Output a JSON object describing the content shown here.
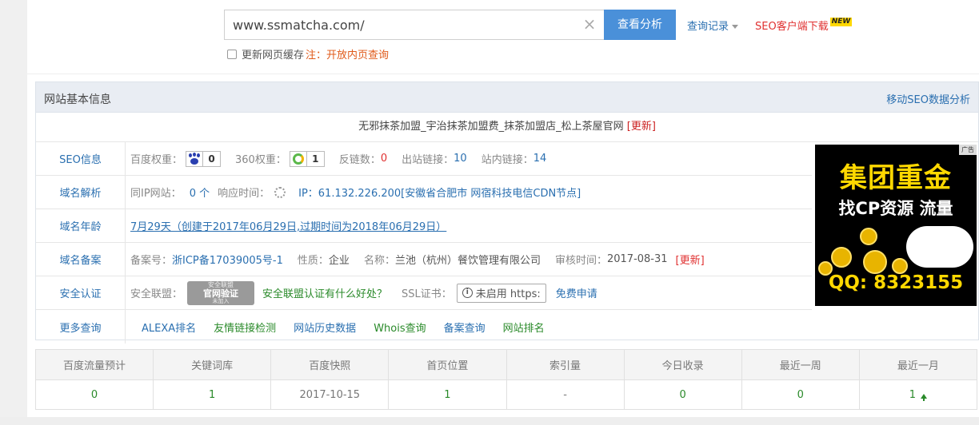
{
  "search": {
    "url_value": "www.ssmatcha.com/",
    "analyze_label": "查看分析",
    "history_label": "查询记录",
    "download_label": "SEO客户端下载",
    "new_badge": "NEW",
    "cache_label": "更新网页缓存",
    "cache_note": "注：开放内页查询"
  },
  "panel": {
    "title": "网站基本信息",
    "mobile_link": "移动SEO数据分析",
    "site_title": "无邪抹茶加盟_宇治抹茶加盟费_抹茶加盟店_松上茶屋官网",
    "site_title_refresh": "[更新]"
  },
  "seo": {
    "label": "SEO信息",
    "baidu_weight_label": "百度权重：",
    "baidu_weight": "0",
    "weight360_label": "360权重：",
    "weight360": "1",
    "backlinks_label": "反链数：",
    "backlinks": "0",
    "outlinks_label": "出站链接：",
    "outlinks": "10",
    "inlinks_label": "站内链接：",
    "inlinks": "14"
  },
  "dns": {
    "label": "域名解析",
    "same_ip_label": "同IP网站：",
    "same_ip": "0 个",
    "response_label": "响应时间：",
    "ip_text": "IP：61.132.226.200[安徽省合肥市 网宿科技电信CDN节点]"
  },
  "age": {
    "label": "域名年龄",
    "text": "7月29天（创建于2017年06月29日,过期时间为2018年06月29日）"
  },
  "icp": {
    "label": "域名备案",
    "number_label": "备案号：",
    "number": "浙ICP备17039005号-1",
    "nature_label": "性质：",
    "nature": "企业",
    "name_label": "名称：",
    "name": "兰池（杭州）餐饮管理有限公司",
    "audit_label": "审核时间：",
    "audit_date": "2017-08-31",
    "refresh": "[更新]"
  },
  "security": {
    "label": "安全认证",
    "alliance_label": "安全联盟：",
    "seal_top": "安全联盟",
    "seal_mid": "官网验证",
    "seal_bot": "未加入",
    "alliance_link": "安全联盟认证有什么好处？",
    "ssl_label": "SSL证书：",
    "ssl_status": "未启用 https:",
    "free_apply": "免费申请"
  },
  "more": {
    "label": "更多查询",
    "links": [
      "ALEXA排名",
      "友情链接检测",
      "网站历史数据",
      "Whois查询",
      "备案查询",
      "网站排名"
    ]
  },
  "ad": {
    "tag": "广告",
    "line1": "集团重金",
    "line2": "找CP资源 流量",
    "line3": "QQ: 8323155"
  },
  "stats": {
    "headers": [
      "百度流量预计",
      "关键词库",
      "百度快照",
      "首页位置",
      "索引量",
      "今日收录",
      "最近一周",
      "最近一月"
    ],
    "values": [
      "0",
      "1",
      "2017-10-15",
      "1",
      "-",
      "0",
      "0",
      "1"
    ]
  },
  "colors": {
    "accent": "#4a90d9",
    "link": "#2a6fb0",
    "green": "#2a8a2a",
    "red": "#e03030"
  }
}
